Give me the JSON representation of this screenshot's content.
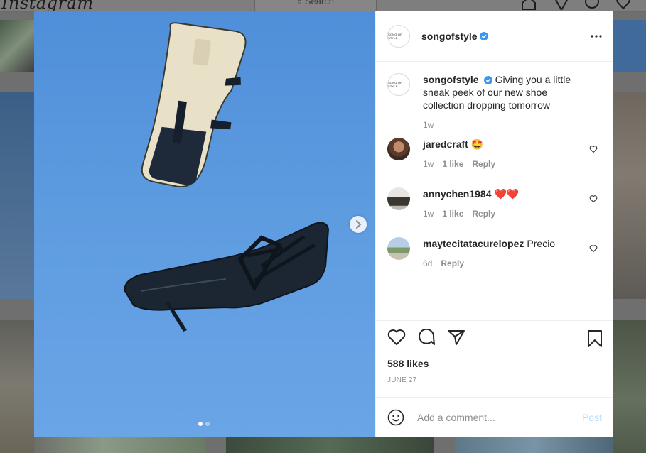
{
  "background": {
    "logo": "Instagram",
    "search_placeholder": "Search",
    "nav_icons": [
      "home-icon",
      "direct-icon",
      "explore-icon",
      "activity-heart-icon"
    ]
  },
  "post": {
    "username": "songofstyle",
    "verified": true,
    "avatar_brand_text": "SONG OF STYLE",
    "media": {
      "slide_count": 2,
      "current_slide": 1
    }
  },
  "comments": [
    {
      "username": "songofstyle",
      "verified": true,
      "text": "Giving you a little sneak peek of our new shoe collection dropping tomorrow",
      "time": "1w",
      "caption": true
    },
    {
      "username": "jaredcraft",
      "text": "🤩",
      "time": "1w",
      "likes": "1 like",
      "reply_label": "Reply"
    },
    {
      "username": "annychen1984",
      "text": "❤️❤️",
      "time": "1w",
      "likes": "1 like",
      "reply_label": "Reply"
    },
    {
      "username": "maytecitatacurelopez",
      "text": "Precio",
      "time": "6d",
      "reply_label": "Reply"
    }
  ],
  "actions": {
    "likes_text": "588 likes",
    "date": "JUNE 27"
  },
  "add_comment": {
    "placeholder": "Add a comment...",
    "post_label": "Post"
  },
  "colors": {
    "verified": "#3897f0",
    "post_button_disabled": "#b2dffc",
    "sky": "#5d9be0"
  }
}
